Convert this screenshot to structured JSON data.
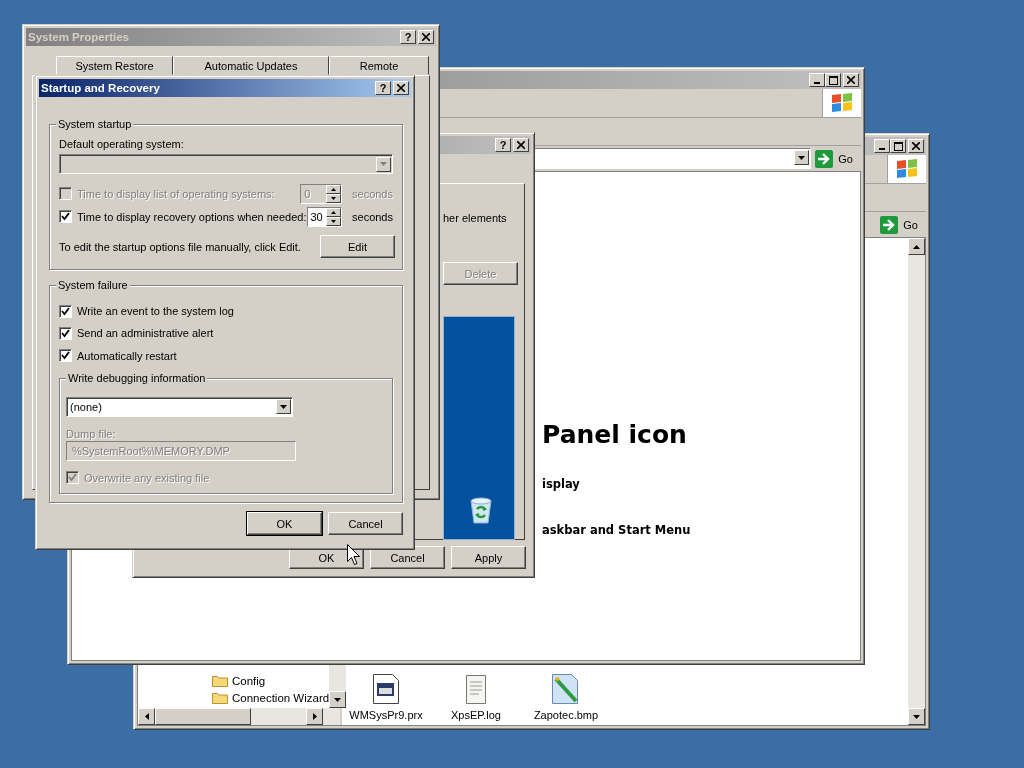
{
  "explorer_window": {
    "active": false,
    "go_label": "Go",
    "tree_items": [
      {
        "label": "Config"
      },
      {
        "label": "Connection Wizard"
      }
    ],
    "files": [
      {
        "name": "WMSysPr9.prx",
        "kind": "program"
      },
      {
        "name": "XpsEP.log",
        "kind": "text"
      },
      {
        "name": "Zapotec.bmp",
        "kind": "image"
      }
    ]
  },
  "browser_window": {
    "active": false,
    "go_label": "Go",
    "content": [
      {
        "text": "Panel icon",
        "kind": "heading"
      },
      {
        "text": "isplay",
        "kind": "link"
      },
      {
        "text": "askbar and Start Menu",
        "kind": "link"
      }
    ]
  },
  "display_dialog": {
    "active": false,
    "help_button": "?",
    "snippet": "her elements",
    "delete_button": {
      "label": "Delete",
      "disabled": true
    },
    "buttons": [
      {
        "label": "OK",
        "default": false
      },
      {
        "label": "Cancel",
        "default": false
      },
      {
        "label": "Apply",
        "default": false
      }
    ]
  },
  "system_properties": {
    "title": "System Properties",
    "active": false,
    "help_button": "?",
    "tabs": [
      {
        "label": "System Restore",
        "selected": false
      },
      {
        "label": "Automatic Updates",
        "selected": false
      },
      {
        "label": "Remote",
        "selected": false
      }
    ]
  },
  "startup_recovery": {
    "title": "Startup and Recovery",
    "active": true,
    "help_button": "?",
    "system_startup": {
      "legend": "System startup",
      "default_os_label": "Default operating system:",
      "default_os_disabled": true,
      "rows": [
        {
          "label": "Time to display list of operating systems:",
          "checked": false,
          "disabled": true,
          "value": "0",
          "unit": "seconds"
        },
        {
          "label": "Time to display recovery options when needed:",
          "checked": true,
          "disabled": false,
          "value": "30",
          "unit": "seconds"
        }
      ],
      "edit_note": "To edit the startup options file manually, click Edit.",
      "edit_button": "Edit"
    },
    "system_failure": {
      "legend": "System failure",
      "options": [
        {
          "label": "Write an event to the system log",
          "checked": true
        },
        {
          "label": "Send an administrative alert",
          "checked": true
        },
        {
          "label": "Automatically restart",
          "checked": true
        }
      ],
      "debug": {
        "legend": "Write debugging information",
        "selection": "(none)",
        "dump_label": "Dump file:",
        "dump_value": "%SystemRoot%\\MEMORY.DMP",
        "disabled": true,
        "overwrite": {
          "label": "Overwrite any existing file",
          "checked": true,
          "disabled": true
        }
      }
    },
    "buttons": [
      {
        "label": "OK",
        "default": true
      },
      {
        "label": "Cancel",
        "default": false
      }
    ]
  }
}
